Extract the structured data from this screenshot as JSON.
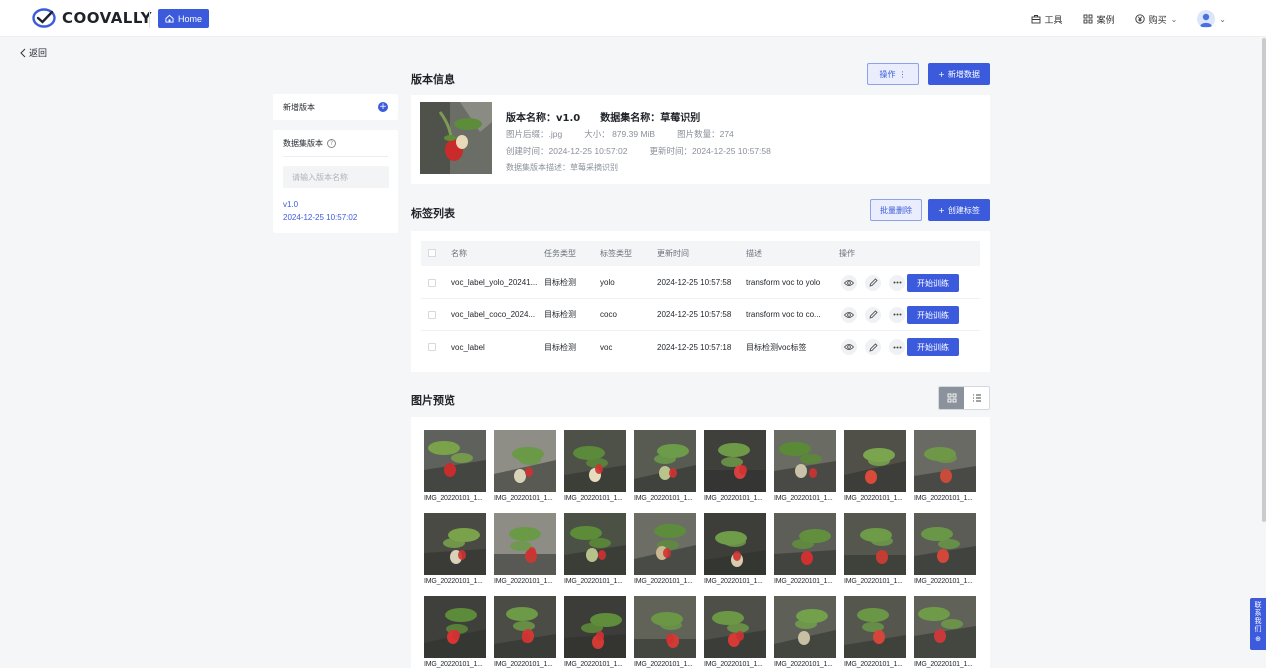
{
  "header": {
    "brand": "COOVALLY",
    "home_label": "Home",
    "nav": {
      "tools": "工具",
      "cases": "案例",
      "purchase": "购买"
    }
  },
  "back_label": "返回",
  "sidebar": {
    "new_version": "新增版本",
    "panel_title": "数据集版本",
    "search_placeholder": "请输入版本名称",
    "versions": [
      {
        "name": "v1.0",
        "date": "2024-12-25 10:57:02"
      }
    ]
  },
  "version_info": {
    "section_title": "版本信息",
    "operate_label": "操作",
    "add_data_label": "新增数据",
    "name_label": "版本名称：",
    "name_value": "v1.0",
    "dataset_label": "数据集名称：",
    "dataset_value": "草莓识别",
    "suffix": "图片后缀：.jpg",
    "size": "大小：  879.39 MiB",
    "count": "图片数量：274",
    "created": "创建时间：2024-12-25 10:57:02",
    "updated": "更新时间：2024-12-25 10:57:58",
    "description": "数据集版本描述：草莓采摘识别"
  },
  "labels": {
    "section_title": "标签列表",
    "batch_delete_label": "批量删除",
    "create_label": "创建标签",
    "columns": [
      "名称",
      "任务类型",
      "标签类型",
      "更新时间",
      "描述",
      "操作"
    ],
    "rows": [
      {
        "name": "voc_label_yolo_20241...",
        "task": "目标检测",
        "type": "yolo",
        "updated": "2024-12-25 10:57:58",
        "desc": "transform voc to yolo",
        "action": "开始训练"
      },
      {
        "name": "voc_label_coco_2024...",
        "task": "目标检测",
        "type": "coco",
        "updated": "2024-12-25 10:57:58",
        "desc": "transform voc to co...",
        "action": "开始训练"
      },
      {
        "name": "voc_label",
        "task": "目标检测",
        "type": "voc",
        "updated": "2024-12-25 10:57:18",
        "desc": "目标检测voc标签",
        "action": "开始训练"
      }
    ]
  },
  "preview": {
    "section_title": "图片预览",
    "captions": [
      "IMG_20220101_1...",
      "IMG_20220101_1...",
      "IMG_20220101_1...",
      "IMG_20220101_1...",
      "IMG_20220101_1...",
      "IMG_20220101_1...",
      "IMG_20220101_1...",
      "IMG_20220101_1...",
      "IMG_20220101_1...",
      "IMG_20220101_1...",
      "IMG_20220101_1...",
      "IMG_20220101_1...",
      "IMG_20220101_1...",
      "IMG_20220101_1...",
      "IMG_20220101_1...",
      "IMG_20220101_1...",
      "IMG_20220101_1...",
      "IMG_20220101_1...",
      "IMG_20220101_1...",
      "IMG_20220101_1...",
      "IMG_20220101_1...",
      "IMG_20220101_1...",
      "IMG_20220101_1...",
      "IMG_20220101_1..."
    ]
  },
  "contact_label": "联系我们",
  "colors": {
    "primary": "#3c5bdc",
    "page_bg": "#f5f6f8"
  }
}
